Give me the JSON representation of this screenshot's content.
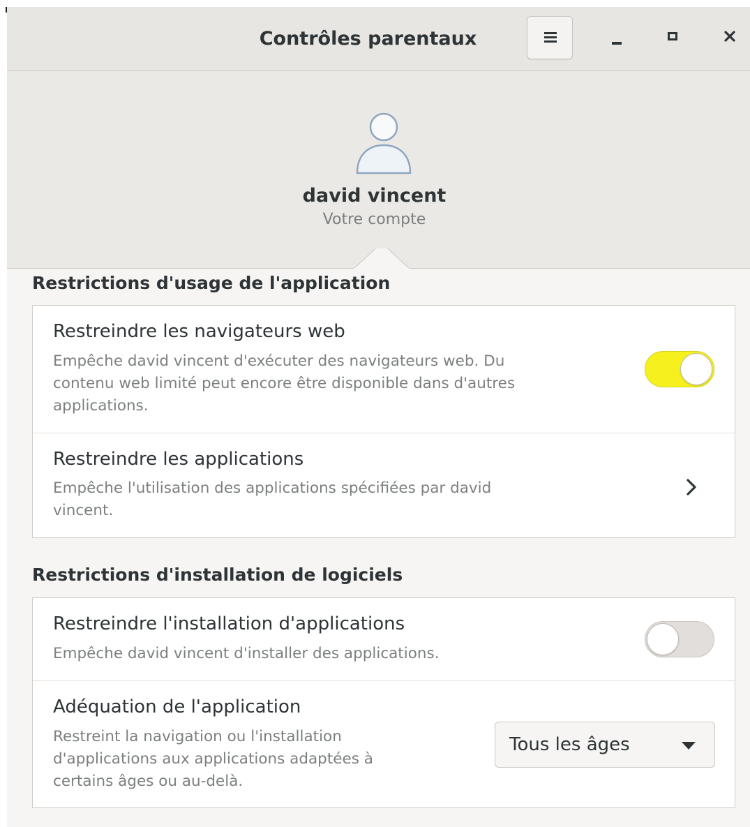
{
  "window": {
    "title": "Contrôles parentaux"
  },
  "user": {
    "name": "david vincent",
    "subtitle": "Votre compte"
  },
  "sections": [
    {
      "heading": "Restrictions d'usage de l'application",
      "rows": [
        {
          "title": "Restreindre les navigateurs web",
          "description_lines": [
            "Empêche david vincent d'exécuter des navigateurs web. Du",
            "contenu web limité peut encore être disponible dans d'autres",
            "applications."
          ],
          "control": "switch",
          "switch_on": true
        },
        {
          "title": "Restreindre les applications",
          "description_lines": [
            "Empêche l'utilisation des applications spécifiées par david",
            "vincent."
          ],
          "control": "chevron-right-icon"
        }
      ]
    },
    {
      "heading": "Restrictions d'installation de logiciels",
      "rows": [
        {
          "title": "Restreindre l'installation d'applications",
          "description_lines": [
            "Empêche david vincent d'installer des applications."
          ],
          "control": "switch",
          "switch_on": false
        },
        {
          "title": "Adéquation de l'application",
          "description_lines": [
            "Restreint la navigation ou l'installation",
            "d'applications aux applications adaptées à",
            "certains âges ou au-delà."
          ],
          "control": "dropdown",
          "dropdown_value": "Tous les âges"
        }
      ]
    }
  ],
  "icons": {
    "menu": "hamburger-menu-icon",
    "minimize": "minimize-icon",
    "maximize": "maximize-icon",
    "close": "close-icon",
    "avatar": "user-avatar-icon",
    "dropdown": "chevron-down-icon"
  },
  "colors": {
    "switch_on": "#f6f01e",
    "switch_off": "#e1dedb",
    "header_bg": "#e8e6e3",
    "text": "#2e3436",
    "dim_text": "#7b7f80"
  }
}
